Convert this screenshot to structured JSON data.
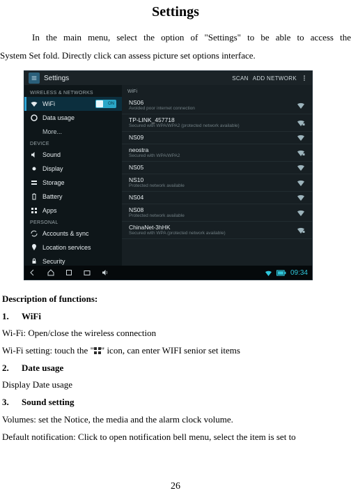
{
  "title": "Settings",
  "intro": {
    "line1": "In the main menu, select the option of \"Settings\" to be able to access the",
    "line2": "System Set fold. Directly click can assess picture set options interface."
  },
  "shot": {
    "topbar": {
      "title": "Settings",
      "scan": "SCAN",
      "add": "ADD NETWORK"
    },
    "sidebar": {
      "section_wireless": "WIRELESS & NETWORKS",
      "wifi": "WiFi",
      "wifi_toggle": "ON",
      "data": "Data usage",
      "more": "More...",
      "section_device": "DEVICE",
      "sound": "Sound",
      "display": "Display",
      "storage": "Storage",
      "battery": "Battery",
      "apps": "Apps",
      "section_personal": "PERSONAL",
      "accounts": "Accounts & sync",
      "location": "Location services",
      "security": "Security"
    },
    "netheader": "WiFi",
    "networks": [
      {
        "name": "NS06",
        "sub": "Avoided poor internet connection",
        "lock": false
      },
      {
        "name": "TP-LINK_457718",
        "sub": "Secured with WPA/WPA2 (protected network available)",
        "lock": true
      },
      {
        "name": "NS09",
        "sub": "",
        "lock": false
      },
      {
        "name": "neostra",
        "sub": "Secured with WPA/WPA2",
        "lock": true
      },
      {
        "name": "NS05",
        "sub": "",
        "lock": false
      },
      {
        "name": "NS10",
        "sub": "Protected network available",
        "lock": false
      },
      {
        "name": "NS04",
        "sub": "",
        "lock": false
      },
      {
        "name": "NS08",
        "sub": "Protected network available",
        "lock": false
      },
      {
        "name": "ChinaNet-3hHK",
        "sub": "Secured with WPA (protected network available)",
        "lock": true
      }
    ],
    "clock": "09:34"
  },
  "desc": {
    "header": "Description of functions:",
    "i1_num": "1.",
    "i1_label": "WiFi",
    "i1_a": "Wi-Fi: Open/close the wireless connection",
    "i1_b_pre": "Wi-Fi setting: touch the \"",
    "i1_b_post": "\" icon, can enter WIFI senior set items",
    "i2_num": "2.",
    "i2_label": "Date usage",
    "i2_a": "Display Date usage",
    "i3_num": "3.",
    "i3_label": "Sound setting",
    "i3_a": "Volumes: set the Notice, the media and the alarm clock volume.",
    "i3_b": "Default notification:  Click to open notification bell menu, select the item is set to"
  },
  "page_number": "26"
}
